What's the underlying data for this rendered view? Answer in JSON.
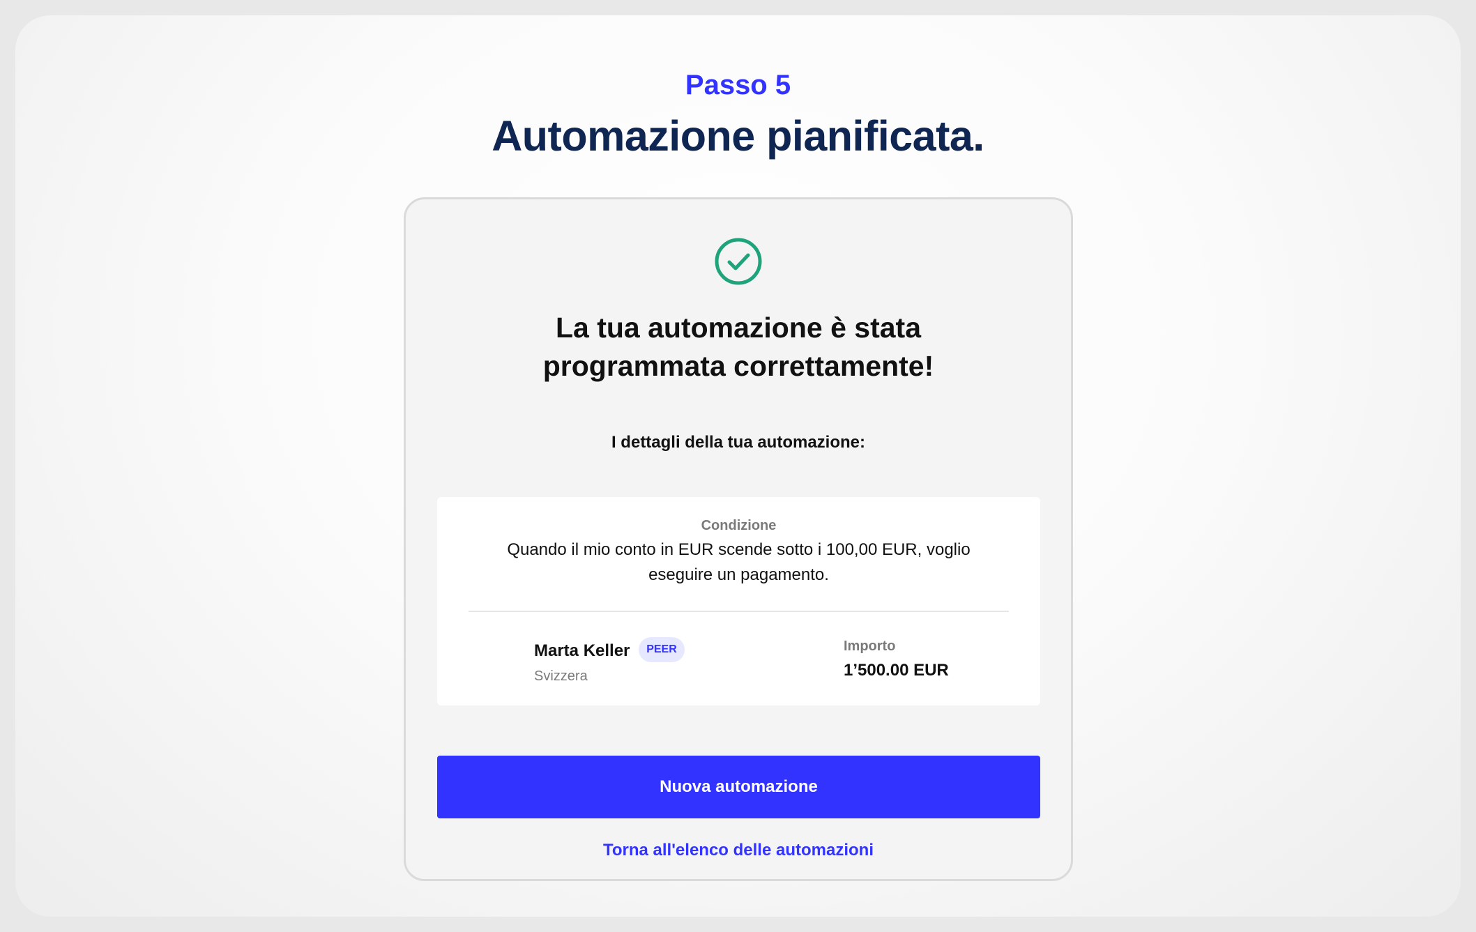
{
  "header": {
    "step_label": "Passo 5",
    "title": "Automazione pianificata."
  },
  "card": {
    "success_icon": "check-circle-icon",
    "success_icon_color": "#1fa37a",
    "title_line1": "La tua automazione è stata",
    "title_line2": "programmata correttamente!",
    "details_heading": "I dettagli della tua automazione:",
    "condition": {
      "label": "Condizione",
      "text_line1": "Quando il mio conto in EUR scende sotto i 100,00 EUR, voglio",
      "text_line2": "eseguire un pagamento."
    },
    "recipient": {
      "name": "Marta Keller",
      "badge": "PEER",
      "country": "Svizzera"
    },
    "amount": {
      "label": "Importo",
      "value": "1’500.00 EUR"
    },
    "primary_button": "Nuova automazione",
    "back_link": "Torna all'elenco delle automazioni"
  },
  "colors": {
    "accent": "#3333ff",
    "title": "#0f2552",
    "success": "#1fa37a"
  }
}
